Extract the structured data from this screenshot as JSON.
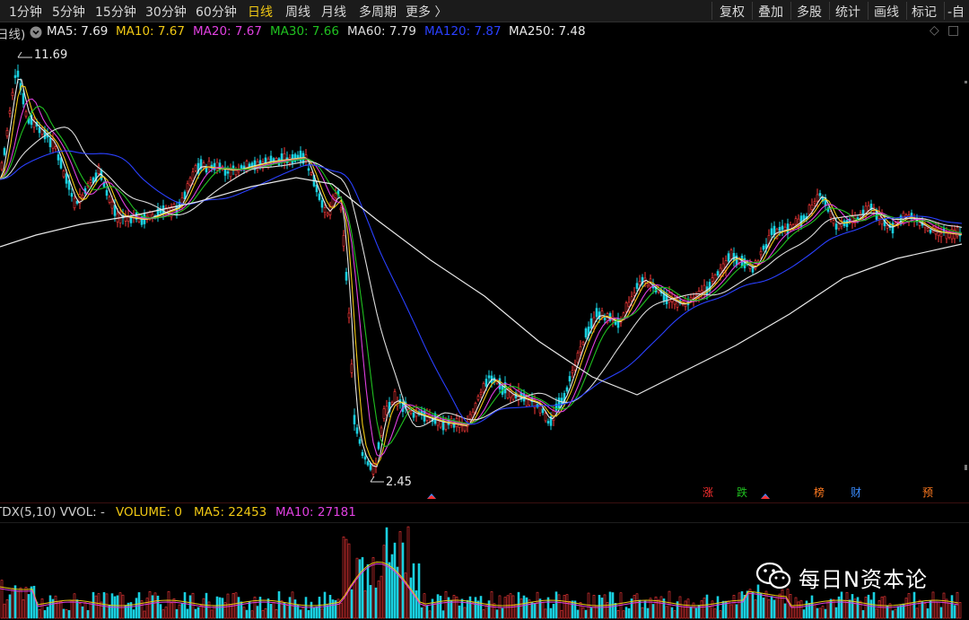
{
  "toolbar": {
    "periods": [
      "1分钟",
      "5分钟",
      "15分钟",
      "30分钟",
      "60分钟",
      "日线",
      "周线",
      "月线",
      "多周期",
      "更多 〉"
    ],
    "active_period": "日线",
    "right_tools": [
      "复权",
      "叠加",
      "多股",
      "统计",
      "画线",
      "标记",
      "-自"
    ]
  },
  "ma_legend": {
    "prefix": "日线)",
    "items": [
      {
        "label": "MA5: 7.69",
        "color": "#e8e8e8"
      },
      {
        "label": "MA10: 7.67",
        "color": "#f0c814"
      },
      {
        "label": "MA20: 7.67",
        "color": "#e040e0"
      },
      {
        "label": "MA30: 7.66",
        "color": "#20c020"
      },
      {
        "label": "MA60: 7.79",
        "color": "#dcdcdc"
      },
      {
        "label": "MA120: 7.87",
        "color": "#2a40ff"
      },
      {
        "label": "MA250: 7.48",
        "color": "#e8e8e8"
      }
    ]
  },
  "price_labels": {
    "high": "11.69",
    "low": "2.45"
  },
  "event_markers": [
    {
      "label": "涨",
      "color": "#ff3030"
    },
    {
      "label": "跌",
      "color": "#20c020"
    },
    {
      "label": "榜",
      "color": "#ff7a20"
    },
    {
      "label": "财",
      "color": "#3a8cff"
    },
    {
      "label": "预",
      "color": "#ff7a20"
    }
  ],
  "volume_legend": {
    "name": "TDX(5,10) VVOL: -",
    "items": [
      {
        "label": "VOLUME: 0",
        "color": "#f0c814"
      },
      {
        "label": "MA5: 22453",
        "color": "#f0c814"
      },
      {
        "label": "MA10: 27181",
        "color": "#e040e0"
      }
    ]
  },
  "watermark": {
    "text": "每日N资本论"
  },
  "colors": {
    "up": "#ff3a3a",
    "down": "#19d0e0",
    "bg": "#000000"
  }
}
